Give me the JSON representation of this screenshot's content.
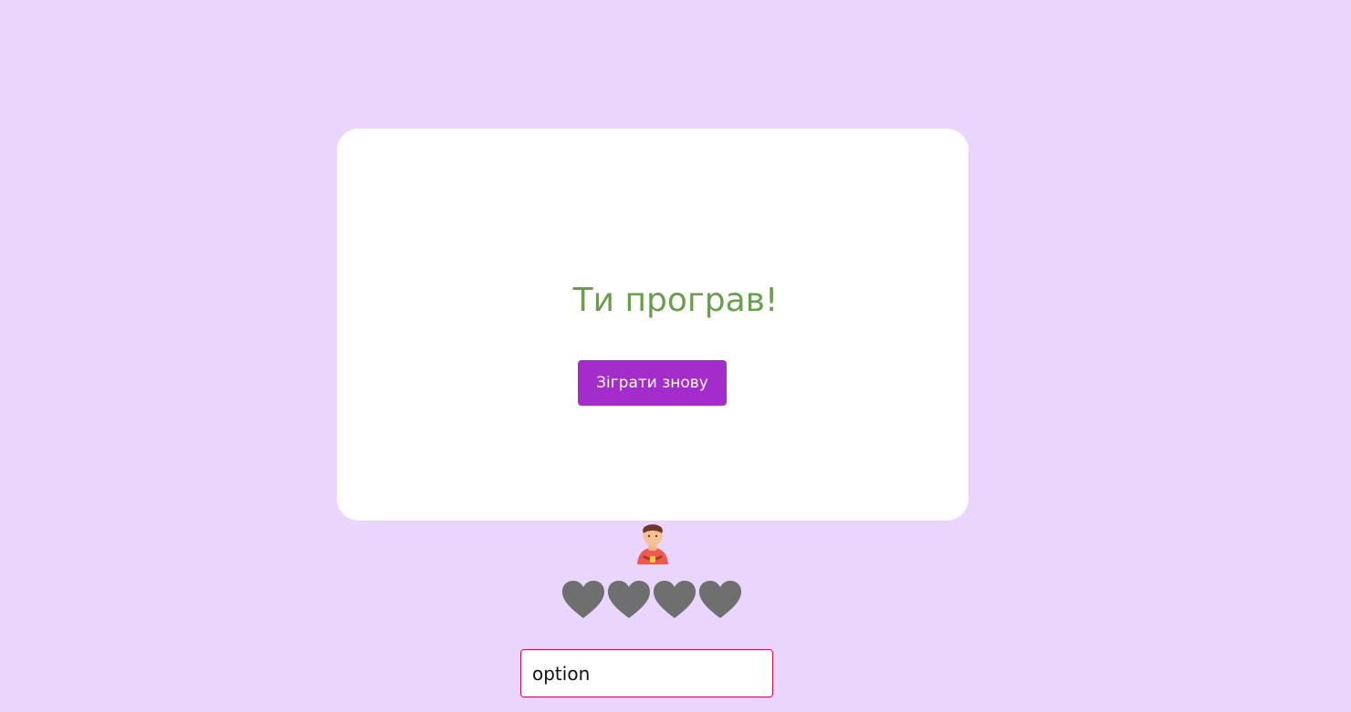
{
  "colors": {
    "background": "#ead6fd",
    "card": "#ffffff",
    "title_text": "#689f4b",
    "button": "#a42ccb",
    "heart": "#6f6f6f",
    "input_border": "#d2144a"
  },
  "game": {
    "result_message": "Ти програв!",
    "play_again_label": "Зіграти знову",
    "player_icon": "player-avatar-icon",
    "lives_total": 4,
    "lives_remaining": 0
  },
  "answer_input": {
    "value": "option"
  }
}
